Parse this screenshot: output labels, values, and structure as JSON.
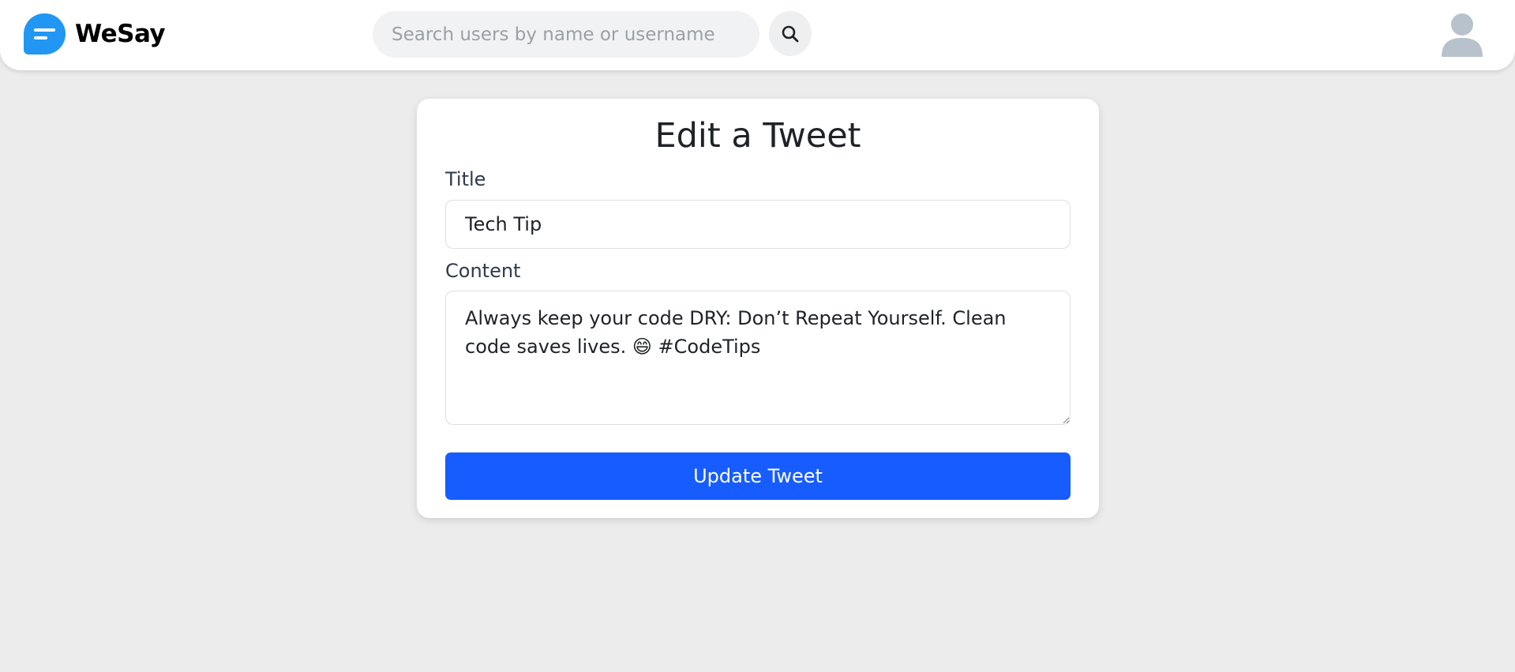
{
  "app": {
    "brand_name": "WeSay",
    "logo_icon": "chat-bubble-icon",
    "accent_color": "#2196f3"
  },
  "header": {
    "search": {
      "placeholder": "Search users by name or username",
      "value": ""
    },
    "search_button_icon": "search-icon",
    "avatar_icon": "user-avatar-icon"
  },
  "form": {
    "heading": "Edit a Tweet",
    "title_label": "Title",
    "title_value": "Tech Tip",
    "content_label": "Content",
    "content_value": "Always keep your code DRY: Don’t Repeat Yourself. Clean code saves lives. 😄 #CodeTips",
    "submit_label": "Update Tweet",
    "submit_color": "#175cff"
  }
}
